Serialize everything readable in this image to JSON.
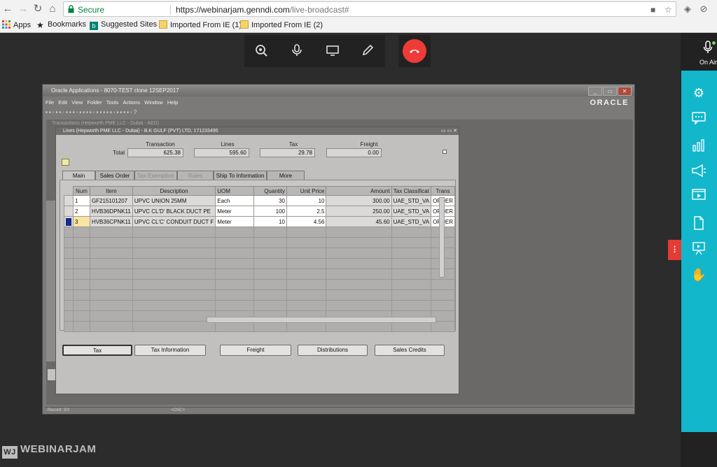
{
  "browser": {
    "secure_label": "Secure",
    "url_host": "https://webinarjam.genndi.com",
    "url_path": "/live-broadcast#",
    "bookmarks": [
      {
        "label": "Apps"
      },
      {
        "label": "Bookmarks"
      },
      {
        "label": "Suggested Sites"
      },
      {
        "label": "Imported From IE (1)"
      },
      {
        "label": "Imported From IE (2)"
      }
    ]
  },
  "webinar": {
    "on_air_label": "On Air",
    "logo_text": "WEBINARJAM",
    "logo_mark": "WJ",
    "accent_color": "#12b7cc",
    "hangup_color": "#ef3b37"
  },
  "oracle": {
    "window_title": "Oracle Applications - 8070-TEST clone 12SEP2017",
    "logo": "ORACLE",
    "menu": [
      "File",
      "Edit",
      "View",
      "Folder",
      "Tools",
      "Actions",
      "Window",
      "Help"
    ],
    "transactions_title": "Transactions (Hepworth PME LLC - Dubai - AED)",
    "lines_title": "Lines (Hepworth PME LLC - Dubai) - B.K GULF (PVT) LTD, 171233495",
    "summary": {
      "row_label": "Total",
      "transaction_label": "Transaction",
      "transaction": "625.38",
      "lines_label": "Lines",
      "lines": "595.60",
      "tax_label": "Tax",
      "tax": "29.78",
      "freight_label": "Freight",
      "freight": "0.00"
    },
    "tabs": [
      {
        "label": "Main",
        "state": "active"
      },
      {
        "label": "Sales Order",
        "state": "normal"
      },
      {
        "label": "Tax Exemption",
        "state": "disabled"
      },
      {
        "label": "Rules",
        "state": "disabled"
      },
      {
        "label": "Ship To Information",
        "state": "normal"
      },
      {
        "label": "More",
        "state": "normal"
      }
    ],
    "columns": [
      "Num",
      "Item",
      "Description",
      "UOM",
      "Quantity",
      "Unit Price",
      "Amount",
      "Tax Classificat",
      "Trans"
    ],
    "rows": [
      [
        "1",
        "GF215101207",
        "UPVC UNION 25MM",
        "Each",
        "30",
        "10",
        "300.00",
        "UAE_STD_VA",
        "ORDER"
      ],
      [
        "2",
        "HVB36DPNK11",
        "UPVC CL'D' BLACK DUCT PE",
        "Meter",
        "100",
        "2.5",
        "250.00",
        "UAE_STD_VA",
        "ORDER"
      ],
      [
        "3",
        "HVB36CPNK11",
        "UPVC CL'C' CONDUIT DUCT F",
        "Meter",
        "10",
        "4.56",
        "45.60",
        "UAE_STD_VA",
        "ORDER"
      ]
    ],
    "buttons": [
      "Tax",
      "Tax Information",
      "Freight",
      "Distributions",
      "Sales Credits"
    ],
    "status": {
      "record": "Record: 3/3",
      "osc": "<OSC>"
    }
  }
}
